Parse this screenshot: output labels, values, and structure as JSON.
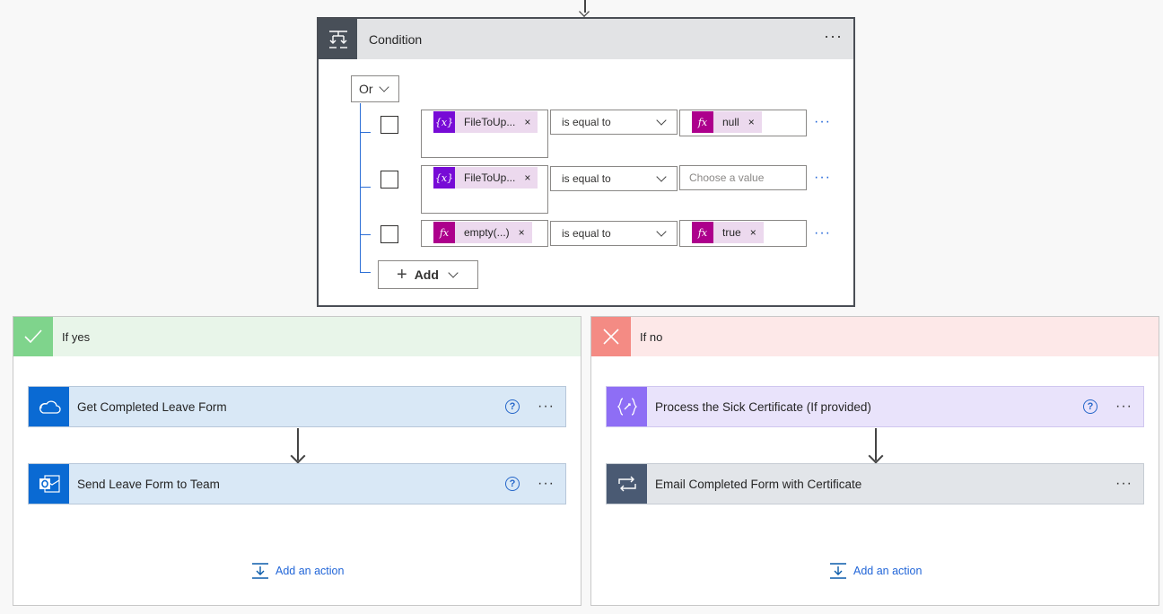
{
  "condition": {
    "title": "Condition",
    "logic_operator": "Or",
    "rows": [
      {
        "left_token": "FileToUp...",
        "operator": "is equal to",
        "right_token": "null",
        "right_placeholder": ""
      },
      {
        "left_token": "FileToUp...",
        "operator": "is equal to",
        "right_token": "",
        "right_placeholder": "Choose a value"
      },
      {
        "left_token": "empty(...)",
        "operator": "is equal to",
        "right_token": "true",
        "right_placeholder": ""
      }
    ],
    "add_label": "Add",
    "token_var_glyph": "{x}",
    "token_fx_glyph": "fx"
  },
  "branch_yes": {
    "title": "If yes",
    "actions": [
      {
        "label": "Get Completed Leave Form",
        "help": "?",
        "icon": "onedrive-icon"
      },
      {
        "label": "Send Leave Form to Team",
        "help": "?",
        "icon": "outlook-icon"
      }
    ],
    "add_action": "Add an action"
  },
  "branch_no": {
    "title": "If no",
    "actions": [
      {
        "label": "Process the Sick Certificate (If provided)",
        "help": "?",
        "icon": "variable-brackets-icon"
      },
      {
        "label": "Email Completed Form with Certificate",
        "help": "",
        "icon": "loop-icon"
      }
    ],
    "add_action": "Add an action"
  },
  "menu_dots": "···",
  "remove_glyph": "×",
  "colors": {
    "condition_header": "#484f58",
    "yes_accent": "#7fd48c",
    "no_accent": "#f48b84",
    "variable_token": "#770bd6",
    "expression_token": "#ad008c",
    "link_blue": "#2266d8"
  }
}
